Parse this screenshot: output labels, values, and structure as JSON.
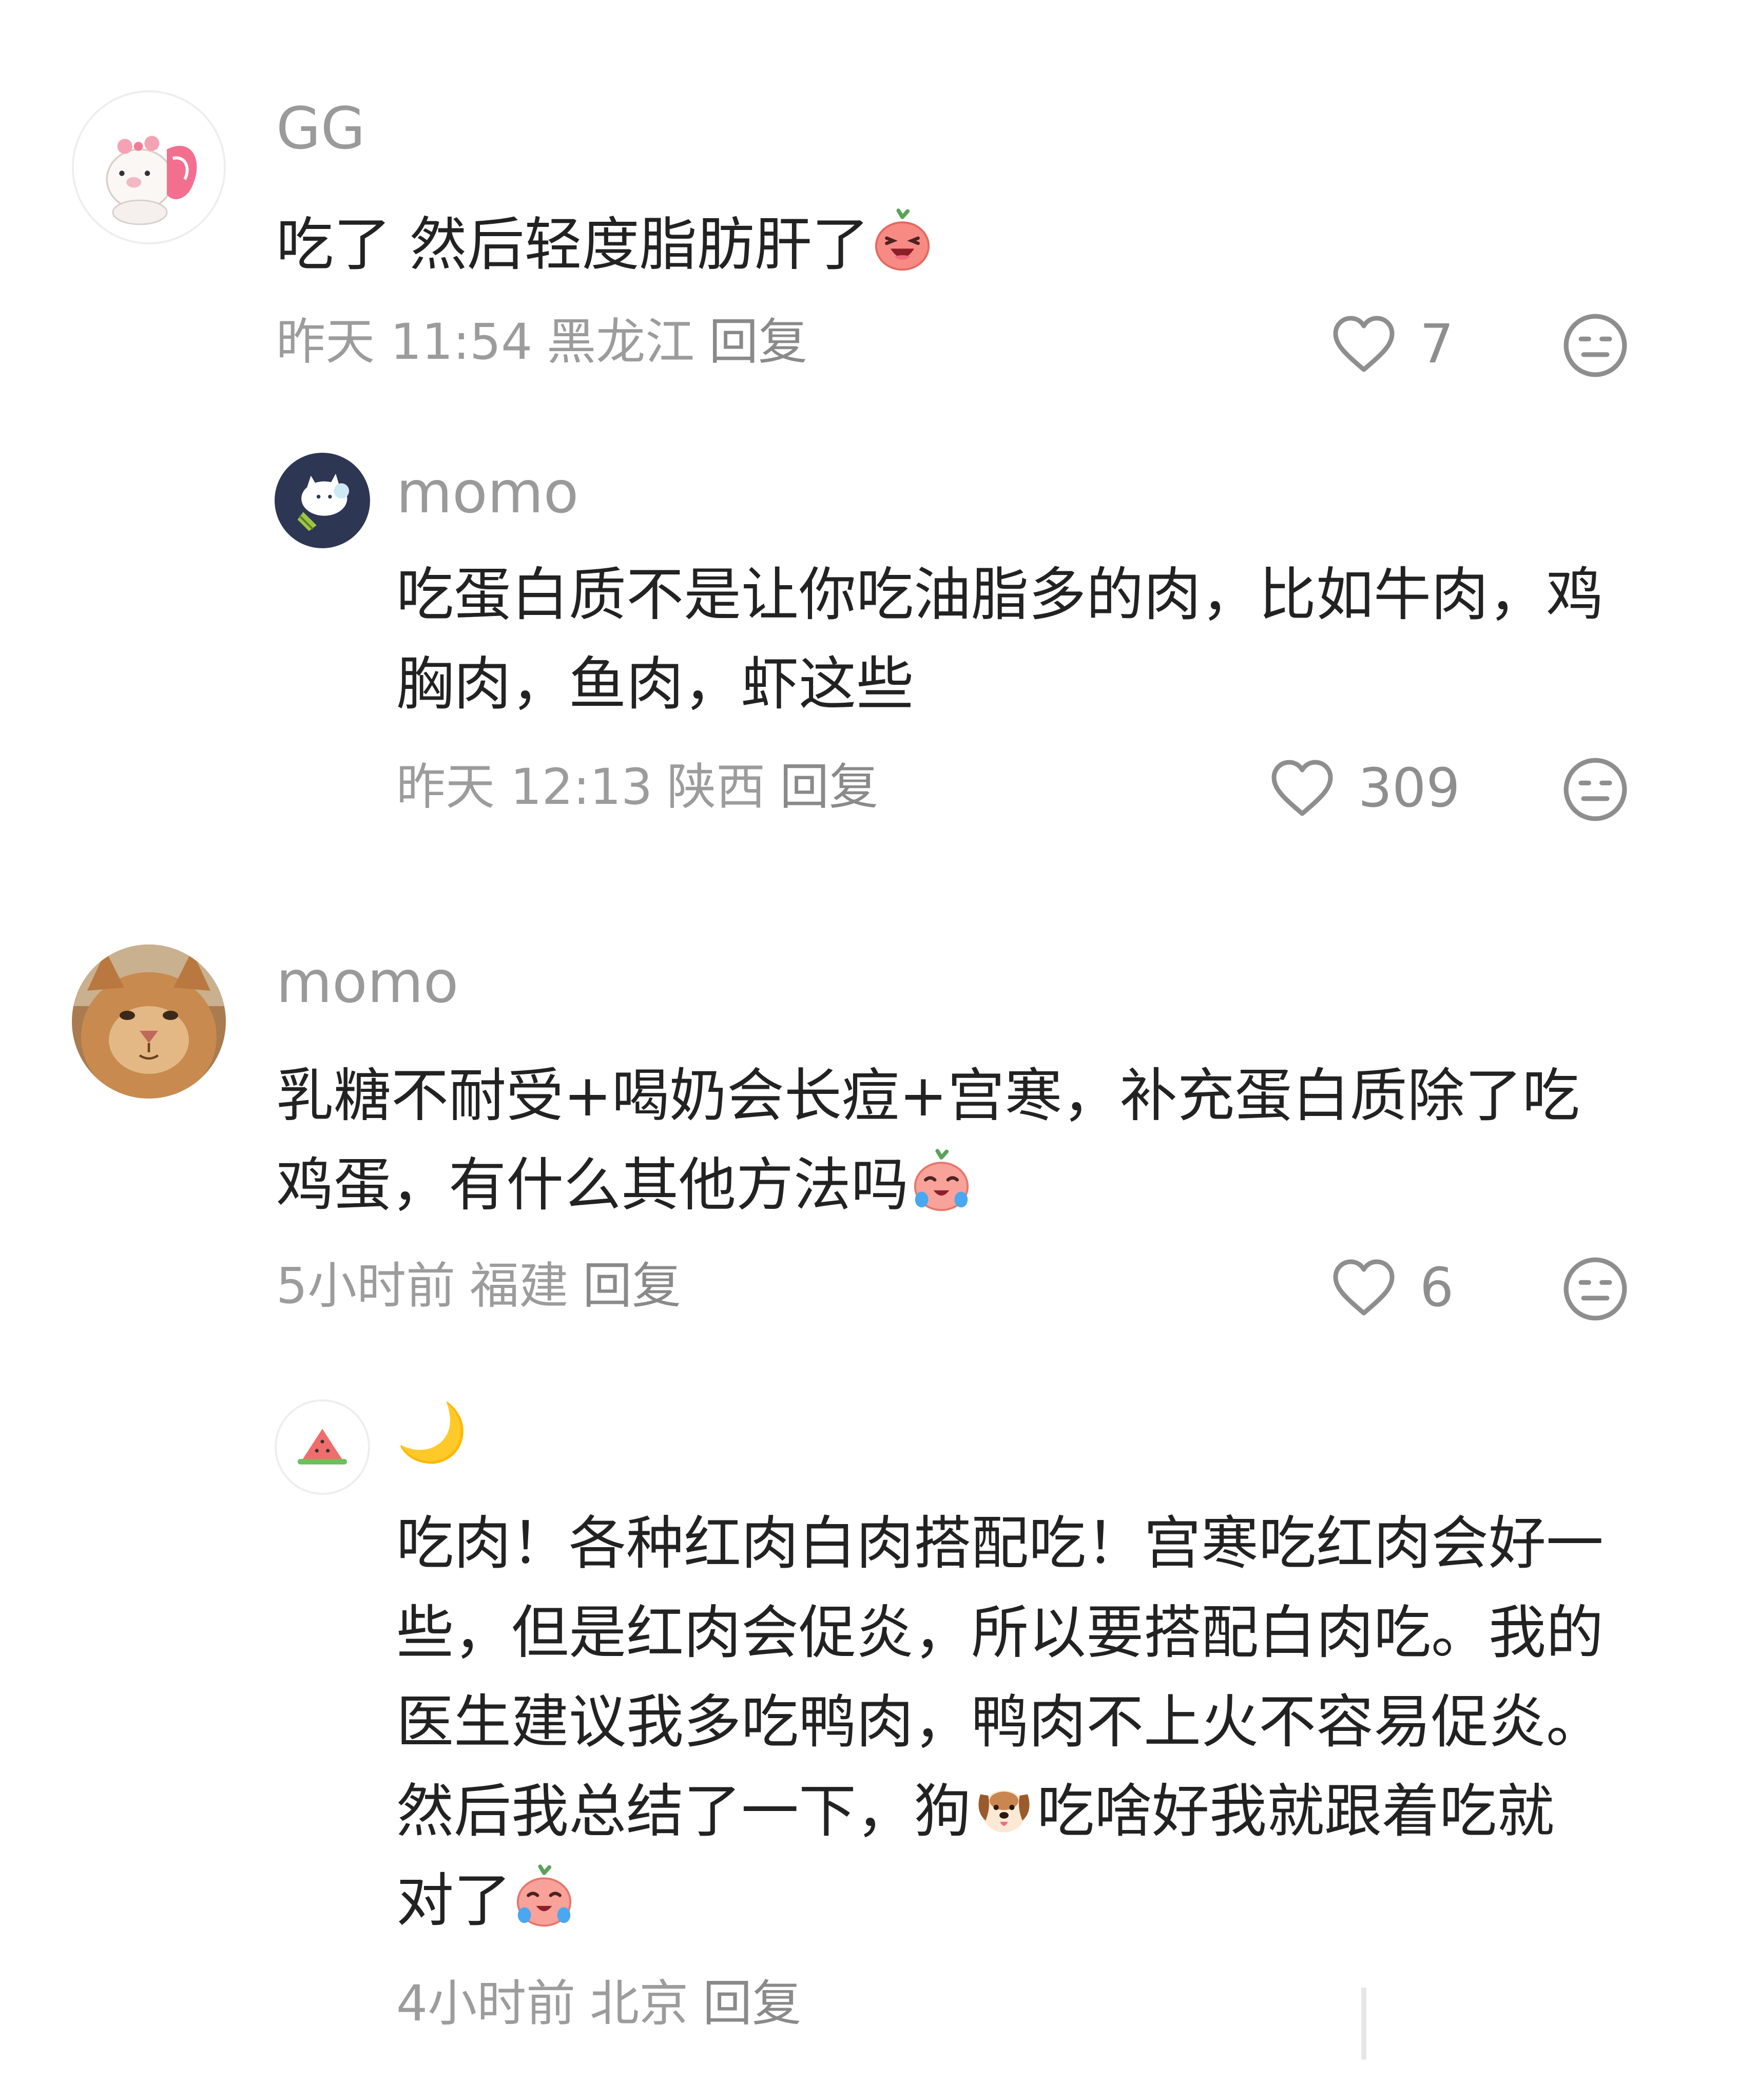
{
  "comments": [
    {
      "username": "GG",
      "text": "吃了 然后轻度脂肪肝了",
      "trailing_emoji": "laughing-radish-emoji",
      "time": "昨天 11:54",
      "location": "黑龙江",
      "reply_label": "回复",
      "likes": "7",
      "avatar": "pink-pig-avatar",
      "replies": [
        {
          "username": "momo",
          "text": "吃蛋白质不是让你吃油脂多的肉，比如牛肉，鸡胸肉，鱼肉，虾这些",
          "time": "昨天 12:13",
          "location": "陕西",
          "reply_label": "回复",
          "likes": "309",
          "avatar": "navy-cat-sticker-avatar"
        }
      ]
    },
    {
      "username": "momo",
      "text": "乳糖不耐受+喝奶会长痘+宫寒，补充蛋白质除了吃鸡蛋，有什么其他方法吗",
      "trailing_emoji": "crying-radish-emoji",
      "time": "5小时前",
      "location": "福建",
      "reply_label": "回复",
      "likes": "6",
      "avatar": "orange-cat-photo-avatar",
      "replies": [
        {
          "username": "🌙",
          "text_part1": "吃肉！各种红肉白肉搭配吃！宫寒吃红肉会好一些，但是红肉会促炎，所以要搭配白肉吃。我的医生建议我多吃鸭肉，鸭肉不上火不容易促炎。然后我总结了一下，狗",
          "text_part2": "吃啥好我就跟着吃就对了",
          "inline_emoji": "dog-face-emoji",
          "trailing_emoji": "crying-radish-emoji",
          "time": "4小时前",
          "location": "北京",
          "reply_label": "回复",
          "avatar": "watermelon-avatar"
        }
      ]
    }
  ],
  "colors": {
    "text": "#222222",
    "meta": "#9c9c9c",
    "icon": "#8e8e8e",
    "background": "#ffffff"
  }
}
